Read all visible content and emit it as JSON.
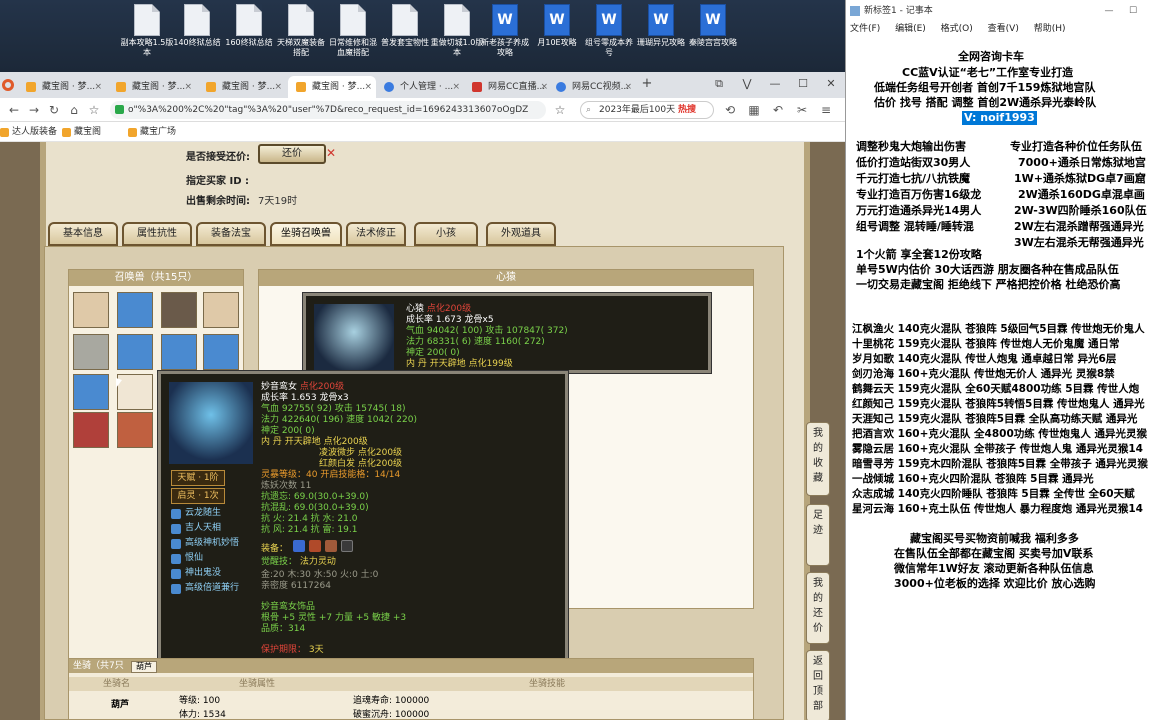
{
  "desktop": {
    "icons": [
      {
        "label": "副本攻略1.5版本",
        "type": "doc"
      },
      {
        "label": "140终狱总结",
        "type": "doc"
      },
      {
        "label": "160终狱总结",
        "type": "doc"
      },
      {
        "label": "天梯双魔装备搭配",
        "type": "doc"
      },
      {
        "label": "日常维修和混血魔搭配",
        "type": "doc"
      },
      {
        "label": "普发套宝物性",
        "type": "doc"
      },
      {
        "label": "重做切城1.0版本",
        "type": "doc"
      },
      {
        "label": "新老孩子养成攻略",
        "type": "word"
      },
      {
        "label": "月10E攻略",
        "type": "word"
      },
      {
        "label": "组号零成本养号",
        "type": "word"
      },
      {
        "label": "珊瑚异兄攻略",
        "type": "word"
      },
      {
        "label": "秦陵宫宫攻略",
        "type": "word"
      }
    ]
  },
  "browser": {
    "tabs": [
      {
        "label": "藏宝阁 · 梦...",
        "fav": "orange"
      },
      {
        "label": "藏宝阁 · 梦...",
        "fav": "orange"
      },
      {
        "label": "藏宝阁 · 梦...",
        "fav": "orange"
      },
      {
        "label": "藏宝阁 · 梦...",
        "fav": "orange"
      },
      {
        "label": "个人管理 · ...",
        "fav": "blue"
      },
      {
        "label": "网易CC直播...",
        "fav": "red"
      },
      {
        "label": "网易CC视频...",
        "fav": "blue"
      }
    ],
    "new_tab": "+",
    "window_controls": [
      "⧉",
      "⋁",
      "—",
      "☐",
      "✕"
    ],
    "url": "o\"%3A%200%2C%20\"tag\"%3A%20\"user\"%7D&reco_request_id=1696243313607oOgDZ",
    "search_text": "2023年最后100天",
    "search_hot": "热搜",
    "bookmarks": [
      "达人版装备",
      "藏宝阁",
      "藏宝广场"
    ]
  },
  "listing": {
    "counter_offer_label": "是否接受还价:",
    "counter_offer_value": "还价",
    "buyer_id_label": "指定买家 ID :",
    "time_left_label": "出售剩余时间:",
    "time_left_value": "7天19时"
  },
  "game_tabs": [
    "基本信息",
    "属性抗性",
    "装备法宝",
    "坐骑召唤兽",
    "法术修正",
    "小孩",
    "外观道具"
  ],
  "active_game_tab": 3,
  "pet_list": {
    "title": "召唤兽（共15只）"
  },
  "heart_panel": {
    "title": "心猿"
  },
  "mount_section": {
    "title": "坐骑（共7只",
    "tab": "葫芦",
    "headers": [
      "坐骑名",
      "坐骑属性",
      "坐骑技能"
    ],
    "name": "葫芦",
    "level_label": "等级:",
    "level": "100",
    "stamina_label": "体力:",
    "stamina": "1534",
    "life_label": "追魂寿命:",
    "life": "100000",
    "immortal_label": "破蜜沉舟:",
    "immortal": "100000"
  },
  "tooltip_back": {
    "name": "心猿",
    "tag": "点化200级",
    "lines": [
      "成长率 1.673 龙骨x5",
      "气血 94042( 100)  攻击 107847( 372)",
      "法力 68331( 6)  速度 1160( 272)",
      "神定 200( 0)",
      "内    丹 开天辟地 点化199级"
    ]
  },
  "tooltip_front": {
    "name": "妙音鸾女",
    "tag": "点化200级",
    "growth": "成长率 1.653 龙骨x3",
    "hp": "气血 92755( 92)  攻击 15745( 18)",
    "mp": "法力 422640( 196)  速度 1042( 220)",
    "fixed": "神定 200( 0)",
    "neidan_1": "内    丹  开天辟地  点化200级",
    "neidan_2": "凌波微步  点化200级",
    "neidan_3": "红颜白发  点化200级",
    "talent_badge": "天赋 · 1阶",
    "spirit_badge": "启灵 · 1次",
    "skills": [
      "云龙随生",
      "吉人天相",
      "高级神机妙悟",
      "恨仙",
      "神出鬼没",
      "高级倍道兼行"
    ],
    "spirit_level": "灵暴等级：40  开启技能格：14/14",
    "refine_count": "炼妖次数 11",
    "resist_1": "抗遗忘: 69.0(30.0+39.0)",
    "resist_2": "抗混乱: 69.0(30.0+39.0)",
    "resist_3": "抗   火: 21.4  抗   水: 21.0",
    "resist_4": "抗   风: 21.4  抗   雷: 19.1",
    "equip_label": "装备：",
    "awaken_label": "觉醒技：",
    "awaken_value": "法力灵动",
    "elements": "金:20 木:30 水:50 火:0 土:0",
    "intimacy": "亲密度 6117264",
    "ornament_title": "妙音鸾女饰品",
    "ornament_stats": "根骨 +5  灵性 +7  力量 +5  敏捷 +3",
    "ornament_quality": "品质：314",
    "protect_label": "保护期限：",
    "protect_value": "3天"
  },
  "side_buttons": [
    {
      "label": "我的收藏"
    },
    {
      "label": "足迹"
    },
    {
      "label": "我的还价"
    },
    {
      "label": "返回顶部"
    }
  ],
  "notepad": {
    "title": "新标签1 - 记事本",
    "window_controls": [
      "—",
      "☐"
    ],
    "menu": [
      "文件(F)",
      "编辑(E)",
      "格式(O)",
      "查看(V)",
      "帮助(H)"
    ],
    "header_lines": [
      "全网咨询卡车",
      "CC蓝V认证“老七”工作室专业打造",
      "低端任务组号开创者          首创7千159炼狱地宫队",
      "估价 找号 搭配 调整          首创2W通杀异光泰岭队"
    ],
    "contact": "V: noif1993",
    "ads_left": [
      "调整秒鬼大炮输出伤害",
      "低价打造站街双30男人",
      "千元打造七抗/八抗铁魔",
      "专业打造百万伤害16级龙",
      "万元打造通杀异光14男人",
      "组号调整 混转睡/睡转混"
    ],
    "ads_right": [
      "专业打造各种价位任务队伍",
      "7000+通杀日常炼狱地宫",
      "1W+通杀炼狱DG卓7画窟",
      "2W通杀160DG卓混卓画",
      "2W-3W四阶睡杀160队伍",
      "2W左右混杀蹭帮强通异光",
      "3W左右混杀无帮强通异光"
    ],
    "promo_lines": [
      "1个火箭 享全套12份攻略",
      "单号5W内估价 30大话西游          朋友圈各种在售成品队伍",
      "一切交易走藏宝阁 拒绝线下     严格把控价格 杜绝恐价高"
    ],
    "team_lines": [
      "江枫渔火 140克火混队 苍狼阵 5级回气5目霖 传世炮无价鬼人",
      "十里桃花 159克火混队 苍狼阵 传世炮人无价鬼魔 通日常",
      "岁月如歌 140克火混队 传世人炮鬼 通卓越日常 异光6层",
      "剑刃沧海 160+克火混队 传世炮无价人 通异光 灵猴8禁",
      "鹤舞云天 159克火混队 全60天赋4800功练 5目霖 传世人炮",
      "红颜知己 159克火混队 苍狼阵5转悟5目霖 传世炮鬼人 通异光",
      "天涯知己 159克火混队 苍狼阵5目霖 全队高功练天赋 通异光",
      "把酒言欢 160+克火混队 全4800功练 传世炮鬼人 通异光灵猴",
      "雾隐云居 160+克火混队 全带孩子 传世炮人鬼 通异光灵猴14",
      "暗雪寻芳 159克木四阶混队 苍狼阵5目霖 全带孩子 通异光灵猴",
      "一战倾城 160+克火四阶混队 苍狼阵 5目霖 通异光",
      "众志成城 140克火四阶睡队 苍狼阵 5目霖 全传世 全60天赋",
      "星河云海 160+克土队伍 传世炮人 暴力程度炮 通异光灵猴14"
    ],
    "footer_lines": [
      "藏宝阁买号买物资前喊我 福利多多",
      "在售队伍全部都在藏宝阁 买卖号加V联系",
      "微信常年1W好友 滚动更新各种队伍信息",
      "3000+位老板的选择 欢迎比价 放心选购"
    ]
  }
}
